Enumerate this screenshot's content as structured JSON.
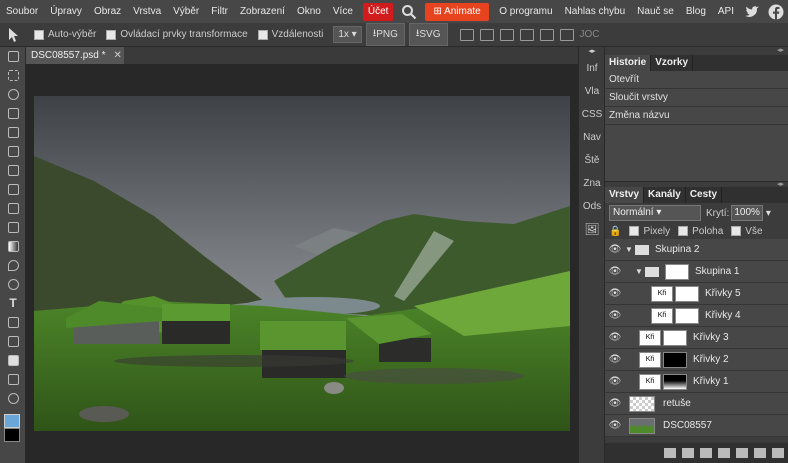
{
  "menu": {
    "items": [
      "Soubor",
      "Úpravy",
      "Obraz",
      "Vrstva",
      "Výběr",
      "Filtr",
      "Zobrazení",
      "Okno",
      "Více"
    ],
    "account": "Účet",
    "animate": "Animate",
    "right_items": [
      "O programu",
      "Nahlas chybu",
      "Nauč se",
      "Blog",
      "API"
    ]
  },
  "options": {
    "auto_select": "Auto-výběr",
    "transform_controls": "Ovládací prvky transformace",
    "distances": "Vzdálenosti",
    "zoom": "1x",
    "png": "PNG",
    "svg": "SVG",
    "align_text": "JOC"
  },
  "document": {
    "tab_title": "DSC08557.psd *"
  },
  "mini_panel": [
    "Inf",
    "Vla",
    "CSS",
    "Nav",
    "Ště",
    "Zna",
    "Ods"
  ],
  "history": {
    "tabs": [
      "Historie",
      "Vzorky"
    ],
    "items": [
      "Otevřít",
      "Sloučit vrstvy",
      "Změna názvu"
    ]
  },
  "layers_panel": {
    "tabs": [
      "Vrstvy",
      "Kanály",
      "Cesty"
    ],
    "blend_mode": "Normální",
    "opacity_label": "Krytí:",
    "opacity_value": "100%",
    "lock_options": [
      "Pixely",
      "Poloha",
      "Vše"
    ],
    "layers": [
      {
        "name": "Skupina 2",
        "type": "group"
      },
      {
        "name": "Skupina 1",
        "type": "group"
      },
      {
        "name": "Křivky 5",
        "type": "adjust"
      },
      {
        "name": "Křivky 4",
        "type": "adjust"
      },
      {
        "name": "Křivky 3",
        "type": "adjust"
      },
      {
        "name": "Křivky 2",
        "type": "adjust"
      },
      {
        "name": "Křivky 1",
        "type": "adjust"
      },
      {
        "name": "retuše",
        "type": "pixel"
      },
      {
        "name": "DSC08557",
        "type": "pixel"
      }
    ],
    "adj_thumb_text": "Kři"
  },
  "colors": {
    "account_red": "#d01c1c",
    "animate_orange": "#e8431f",
    "foreground": "#6aa6d8",
    "background": "#000000"
  }
}
